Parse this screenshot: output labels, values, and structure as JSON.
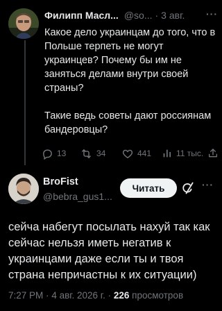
{
  "tweet": {
    "author_name": "Филипп Масл...",
    "handle": "@so...",
    "separator": "·",
    "date": "3 авг.",
    "more": "···",
    "text_paragraph_1": "Какое дело украинцам до того, что в Польше терпеть не могут украинцев? Почему бы им не заняться делами внутри своей страны?",
    "text_paragraph_2": "Такие ведь советы дают россиянам бандеровцы?",
    "stats": {
      "replies": "13",
      "retweets": "34",
      "likes": "441",
      "views": "11 тыс."
    }
  },
  "reply": {
    "author_name": "BroFist",
    "handle": "@bebra_gus1...",
    "follow_label": "Читать",
    "more": "···",
    "text": "сейча набегут посылать нахуй так как сейчас нельзя иметь негатив к украинцами даже если ты и твоя страна непричастны к их ситуации)",
    "time": "7:27 PM",
    "date": "4 авг. 2026 г.",
    "separator": "·",
    "views_count": "226",
    "views_label": "просмотров"
  },
  "colors": {
    "background": "#000000",
    "text": "#e7e9ea",
    "muted": "#71767b",
    "button_bg": "#eff3f4"
  },
  "icons": [
    "reply-icon",
    "retweet-icon",
    "like-icon",
    "views-icon",
    "share-icon",
    "grok-icon"
  ]
}
